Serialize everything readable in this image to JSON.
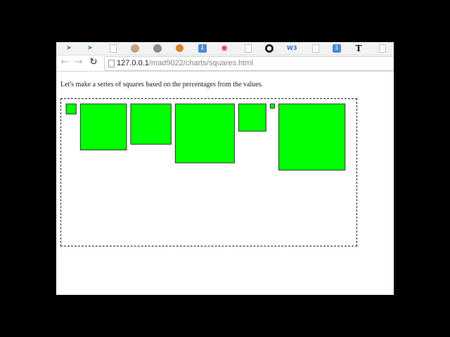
{
  "browser": {
    "bookmark_icons": [
      "arrow-icon",
      "arrow-icon",
      "page-icon",
      "avatar-icon",
      "avatar-icon",
      "orange-circle-icon",
      "download-icon",
      "red-gear-icon",
      "page-icon",
      "github-icon",
      "w3-icon",
      "page-icon",
      "download-icon",
      "typewriter-icon",
      "page-icon"
    ],
    "address": {
      "host": "127.0.0.1",
      "path": "/mad9022/charts/squares.html"
    }
  },
  "page": {
    "intro": "Let's make a series of squares based on the percentages from the values."
  },
  "chart_data": {
    "type": "bar",
    "title": "",
    "description_mark": "square",
    "values_percent": [
      3.5,
      16,
      14,
      20.5,
      9.5,
      1.5,
      23
    ],
    "fill": "#00ff00",
    "stroke": "#333333",
    "container_border": "dashed"
  }
}
